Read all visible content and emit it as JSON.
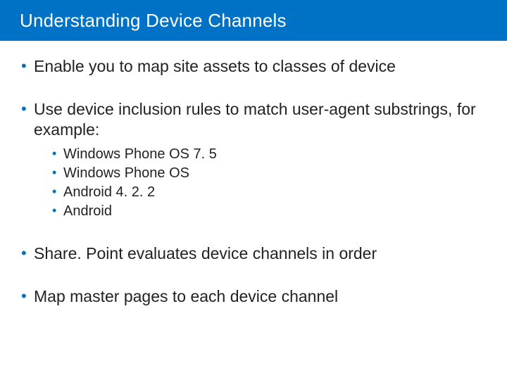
{
  "title": "Understanding Device Channels",
  "bullets": [
    {
      "text": "Enable you to map site assets to classes of device"
    },
    {
      "text": "Use device inclusion rules to match user-agent substrings, for example:",
      "sub": [
        "Windows Phone OS 7. 5",
        "Windows Phone OS",
        "Android 4. 2. 2",
        "Android"
      ]
    },
    {
      "text": "Share. Point evaluates device channels in order"
    },
    {
      "text": "Map master pages to each device channel"
    }
  ],
  "colors": {
    "accent": "#0072c6"
  }
}
